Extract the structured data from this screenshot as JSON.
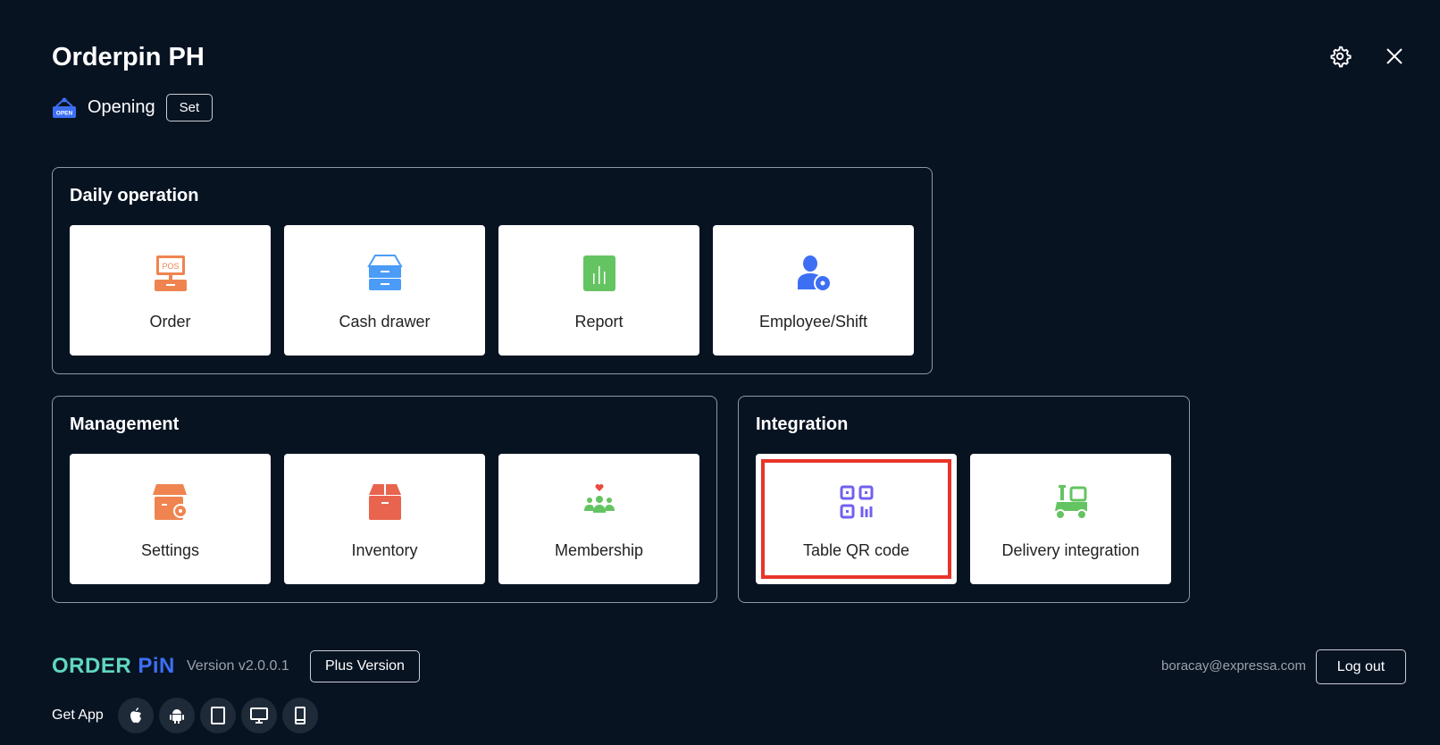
{
  "header": {
    "title": "Orderpin PH",
    "status_label": "Opening",
    "status_icon_text": "OPEN",
    "set_label": "Set"
  },
  "sections": {
    "daily": {
      "title": "Daily operation",
      "items": [
        {
          "label": "Order",
          "icon": "pos-icon"
        },
        {
          "label": "Cash drawer",
          "icon": "cash-drawer-icon"
        },
        {
          "label": "Report",
          "icon": "report-icon"
        },
        {
          "label": "Employee/Shift",
          "icon": "employee-icon"
        }
      ]
    },
    "management": {
      "title": "Management",
      "items": [
        {
          "label": "Settings",
          "icon": "store-settings-icon"
        },
        {
          "label": "Inventory",
          "icon": "box-icon"
        },
        {
          "label": "Membership",
          "icon": "members-icon"
        }
      ]
    },
    "integration": {
      "title": "Integration",
      "items": [
        {
          "label": "Table QR code",
          "icon": "qr-icon"
        },
        {
          "label": "Delivery integration",
          "icon": "scooter-icon"
        }
      ]
    }
  },
  "footer": {
    "logo_a": "ORDER ",
    "logo_b": "PiN",
    "version": "Version v2.0.0.1",
    "plus_label": "Plus Version",
    "get_app": "Get App",
    "email": "boracay@expressa.com",
    "logout_label": "Log out"
  },
  "colors": {
    "bg": "#081322",
    "highlight": "#e8352a",
    "logo_teal": "#5fd8c0",
    "logo_blue": "#3d6ff5"
  }
}
